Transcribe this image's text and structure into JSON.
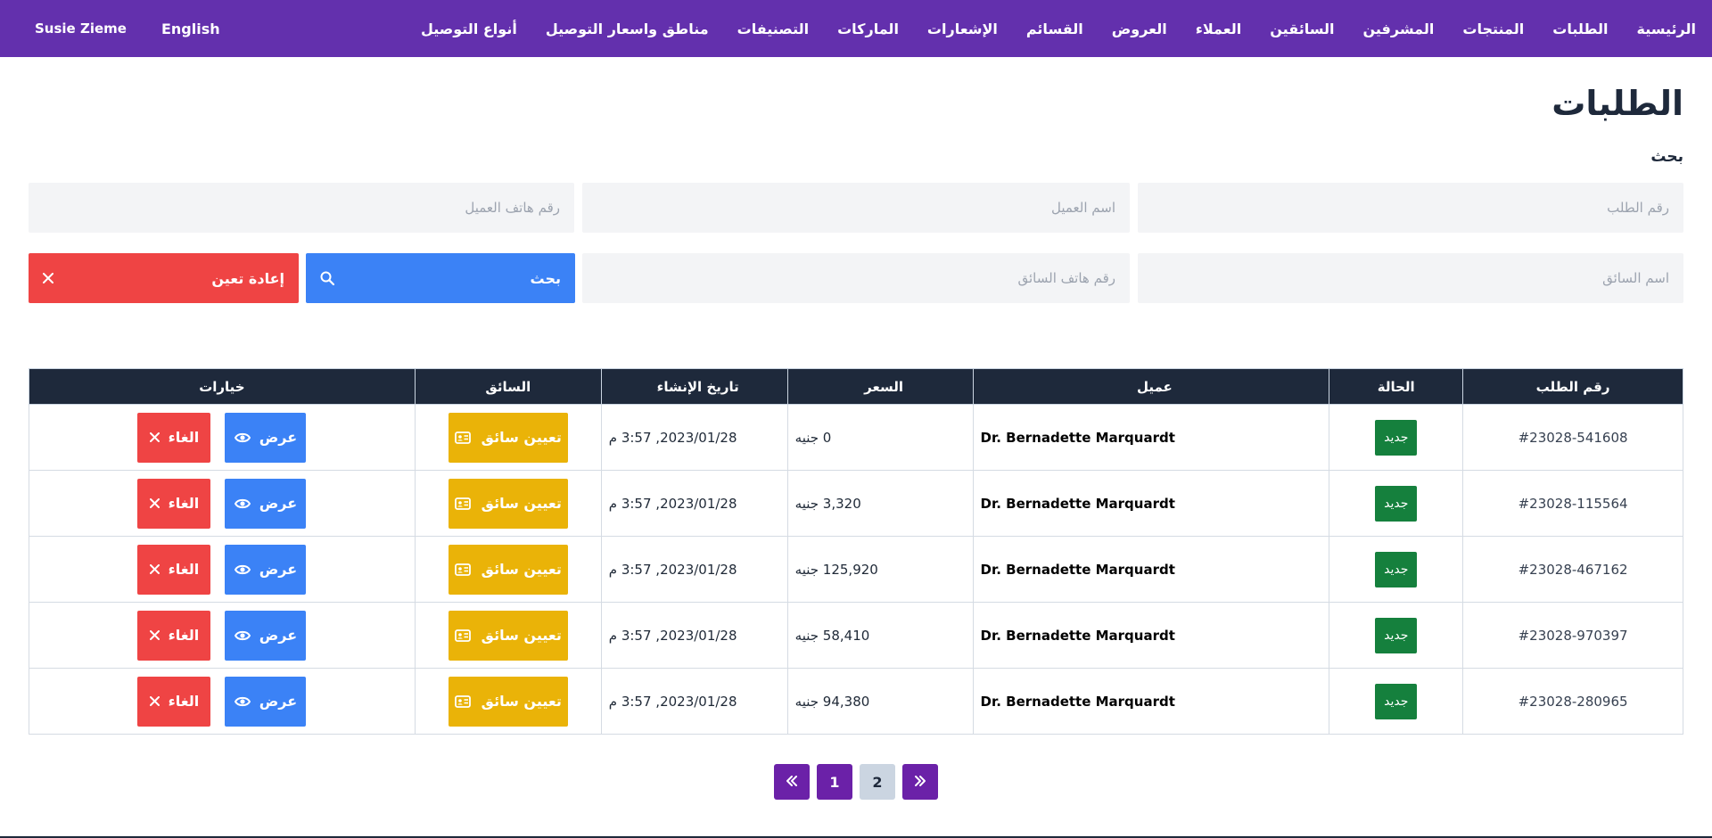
{
  "nav": {
    "items": [
      "الرئيسية",
      "الطلبات",
      "المنتجات",
      "المشرفين",
      "السائقين",
      "العملاء",
      "العروض",
      "القسائم",
      "الإشعارات",
      "الماركات",
      "التصنيفات",
      "مناطق واسعار التوصيل",
      "أنواع التوصيل"
    ],
    "user_name": "Susie Zieme",
    "language": "English"
  },
  "page": {
    "title": "الطلبات",
    "search_label": "بحث"
  },
  "search": {
    "order_number_placeholder": "رقم الطلب",
    "client_name_placeholder": "اسم العميل",
    "client_phone_placeholder": "رقم هاتف العميل",
    "driver_name_placeholder": "اسم السائق",
    "driver_phone_placeholder": "رقم هاتف السائق",
    "search_button": "بحث",
    "reset_button": "إعادة تعين"
  },
  "table": {
    "headers": {
      "order_number": "رقم الطلب",
      "status": "الحالة",
      "client": "عميل",
      "price": "السعر",
      "created_at": "تاريخ الإنشاء",
      "driver": "السائق",
      "options": "خيارات"
    },
    "rows": [
      {
        "order_number": "#23028-541608",
        "status": "جديد",
        "client": "Dr. Bernadette Marquardt",
        "price": "0 جنيه",
        "created_at": "2023/01/28, 3:57 م",
        "assign_label": "تعيين سائق",
        "view_label": "عرض",
        "cancel_label": "الغاء"
      },
      {
        "order_number": "#23028-115564",
        "status": "جديد",
        "client": "Dr. Bernadette Marquardt",
        "price": "3,320 جنيه",
        "created_at": "2023/01/28, 3:57 م",
        "assign_label": "تعيين سائق",
        "view_label": "عرض",
        "cancel_label": "الغاء"
      },
      {
        "order_number": "#23028-467162",
        "status": "جديد",
        "client": "Dr. Bernadette Marquardt",
        "price": "125,920 جنيه",
        "created_at": "2023/01/28, 3:57 م",
        "assign_label": "تعيين سائق",
        "view_label": "عرض",
        "cancel_label": "الغاء"
      },
      {
        "order_number": "#23028-970397",
        "status": "جديد",
        "client": "Dr. Bernadette Marquardt",
        "price": "58,410 جنيه",
        "created_at": "2023/01/28, 3:57 م",
        "assign_label": "تعيين سائق",
        "view_label": "عرض",
        "cancel_label": "الغاء"
      },
      {
        "order_number": "#23028-280965",
        "status": "جديد",
        "client": "Dr. Bernadette Marquardt",
        "price": "94,380 جنيه",
        "created_at": "2023/01/28, 3:57 م",
        "assign_label": "تعيين سائق",
        "view_label": "عرض",
        "cancel_label": "الغاء"
      }
    ]
  },
  "pagination": {
    "pages": [
      "1",
      "2"
    ],
    "current": "2",
    "first_icon": "double-chevron-left-icon",
    "last_icon": "double-chevron-right-icon"
  },
  "colors": {
    "nav_bg": "#6330ad",
    "primary": "#3b82f6",
    "danger": "#ef4444",
    "warning": "#eab308",
    "success": "#15803d",
    "table_header": "#1e293b",
    "pagination": "#6b21a8"
  }
}
